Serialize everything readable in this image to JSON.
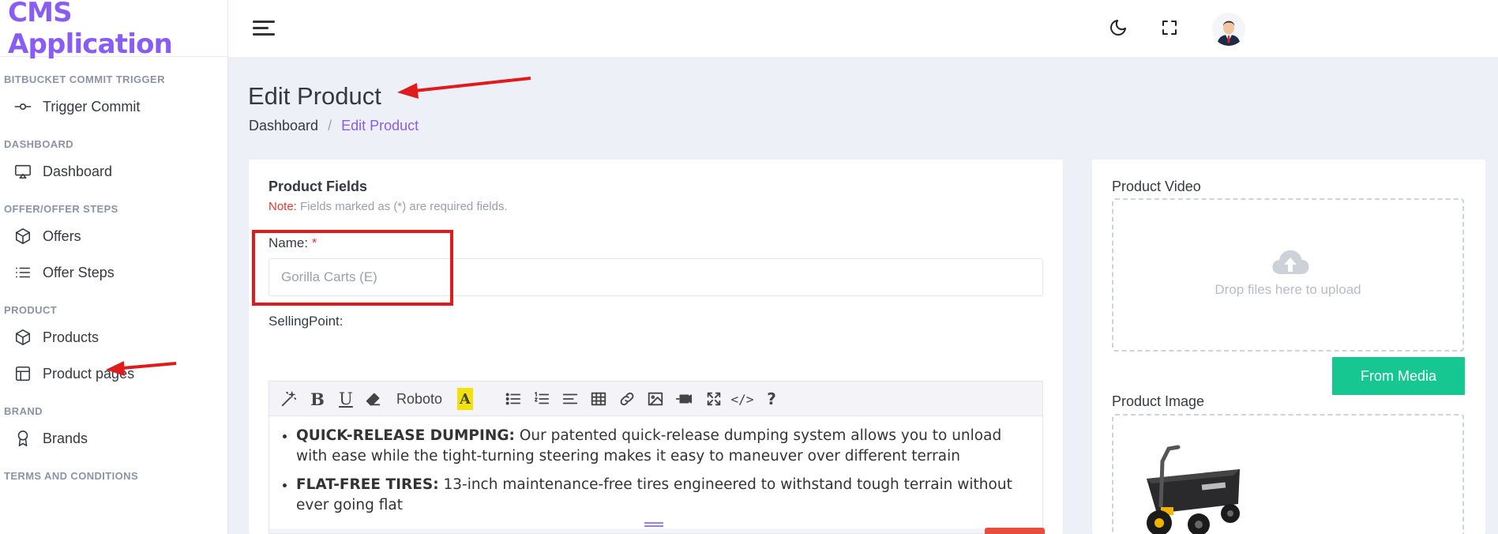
{
  "app": {
    "title": "CMS Application"
  },
  "sidebar": {
    "sections": [
      {
        "title": "BITBUCKET COMMIT TRIGGER",
        "items": [
          {
            "label": "Trigger Commit",
            "icon": "commit-icon"
          }
        ]
      },
      {
        "title": "DASHBOARD",
        "items": [
          {
            "label": "Dashboard",
            "icon": "monitor-icon"
          }
        ]
      },
      {
        "title": "OFFER/OFFER STEPS",
        "items": [
          {
            "label": "Offers",
            "icon": "box-icon"
          },
          {
            "label": "Offer Steps",
            "icon": "list-icon"
          }
        ]
      },
      {
        "title": "PRODUCT",
        "items": [
          {
            "label": "Products",
            "icon": "box-icon"
          },
          {
            "label": "Product pages",
            "icon": "layout-icon"
          }
        ]
      },
      {
        "title": "BRAND",
        "items": [
          {
            "label": "Brands",
            "icon": "award-icon"
          }
        ]
      },
      {
        "title": "TERMS AND CONDITIONS",
        "items": []
      }
    ]
  },
  "topbar": {
    "icons": [
      "hamburger-icon",
      "moon-icon",
      "fullscreen-icon",
      "avatar"
    ]
  },
  "page": {
    "title": "Edit Product",
    "breadcrumb": {
      "home": "Dashboard",
      "separator": "/",
      "current": "Edit Product"
    }
  },
  "form": {
    "card_title": "Product Fields",
    "note_label": "Note:",
    "note_text": " Fields marked as (*) are required fields.",
    "name_label": "Name:",
    "required_mark": "*",
    "name_value": "Gorilla Carts (E)",
    "selling_point_label": "SellingPoint:",
    "editor": {
      "font_name": "Roboto",
      "highlight_letter": "A",
      "bullets": [
        {
          "title": "QUICK-RELEASE DUMPING:",
          "text": " Our patented quick-release dumping system allows you to unload with ease while the tight-turning steering makes it easy to maneuver over different terrain"
        },
        {
          "title": "FLAT-FREE TIRES:",
          "text": " 13-inch maintenance-free tires engineered to withstand tough terrain without ever going flat"
        }
      ]
    }
  },
  "media": {
    "video_title": "Product Video",
    "drop_text": "Drop files here to upload",
    "from_media": "From Media",
    "image_title": "Product Image"
  },
  "colors": {
    "accent": "#8a5cf6",
    "button_green": "#16c792",
    "annotation_red": "#e01b1b"
  }
}
